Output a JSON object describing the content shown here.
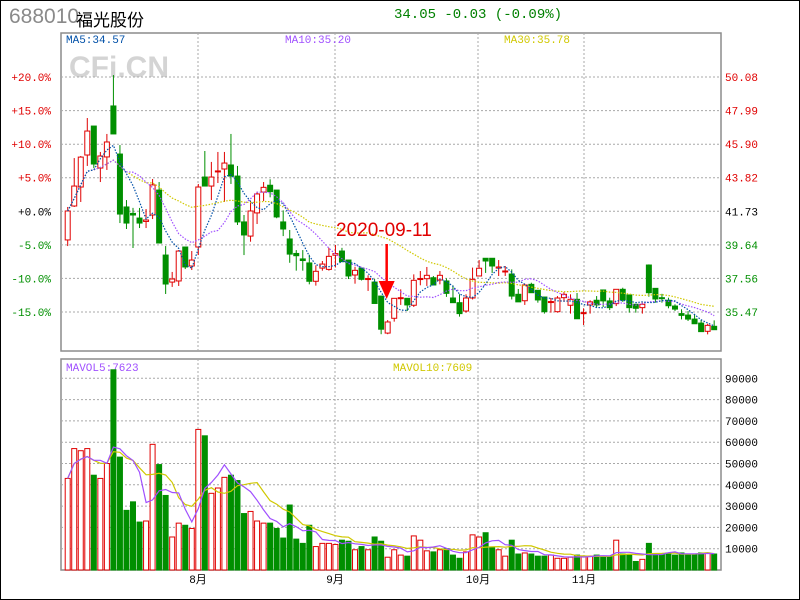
{
  "header": {
    "code": "688010",
    "name": "福光股份",
    "quote": "34.05 -0.03 (-0.09%)"
  },
  "watermark": "CFi.CN",
  "colors": {
    "up": "#e00000",
    "down": "#008f00",
    "ma5": "#0050a8",
    "ma10": "#a050ff",
    "ma30": "#d0c800",
    "grid": "#a8a8a8",
    "frame": "#8c8c8c"
  },
  "chart_data": [
    {
      "type": "candlestick",
      "title": "MA5:34.57  MA10:35.20  MA30:35.78",
      "legend": [
        "MA5:34.57",
        "MA10:35.20",
        "MA30:35.78"
      ],
      "base_price": 41.73,
      "ylim": [
        33.9,
        50.8
      ],
      "left_ticks": [
        {
          "value": 50.08,
          "label": "+20.0%"
        },
        {
          "value": 47.99,
          "label": "+15.0%"
        },
        {
          "value": 45.9,
          "label": "+10.0%"
        },
        {
          "value": 43.82,
          "label": "+5.0%"
        },
        {
          "value": 41.73,
          "label": "+0.0%"
        },
        {
          "value": 39.64,
          "label": "-5.0%"
        },
        {
          "value": 37.56,
          "label": "-10.0%"
        },
        {
          "value": 35.47,
          "label": "-15.0%"
        }
      ],
      "right_ticks": [
        "50.08",
        "47.99",
        "45.90",
        "43.82",
        "41.73",
        "39.64",
        "37.56",
        "35.47"
      ],
      "annotation": {
        "label": "2020-09-11",
        "candle_index": 49
      },
      "ohlc": [
        [
          39.95,
          42.0,
          39.57,
          41.75
        ],
        [
          42.06,
          45.04,
          42.0,
          43.3
        ],
        [
          43.24,
          45.17,
          42.31,
          45.1
        ],
        [
          45.23,
          47.53,
          44.55,
          46.72
        ],
        [
          47.03,
          47.03,
          44.42,
          44.67
        ],
        [
          44.42,
          45.42,
          43.55,
          45.17
        ],
        [
          45.11,
          46.54,
          44.3,
          46.04
        ],
        [
          48.28,
          50.2,
          46.54,
          46.54
        ],
        [
          45.29,
          45.85,
          41.0,
          41.56
        ],
        [
          42.0,
          42.43,
          40.63,
          41.0
        ],
        [
          41.6,
          41.94,
          39.45,
          41.5
        ],
        [
          41.31,
          41.94,
          40.69,
          41.0
        ],
        [
          41.1,
          41.87,
          40.69,
          41.19
        ],
        [
          41.5,
          43.74,
          41.25,
          43.37
        ],
        [
          43.05,
          43.55,
          39.76,
          39.76
        ],
        [
          39.01,
          39.57,
          36.59,
          37.21
        ],
        [
          37.33,
          37.96,
          37.03,
          37.52
        ],
        [
          37.4,
          39.32,
          37.09,
          39.26
        ],
        [
          39.51,
          39.51,
          38.14,
          38.27
        ],
        [
          38.33,
          39.26,
          38.08,
          38.7
        ],
        [
          39.51,
          43.43,
          39.01,
          43.24
        ],
        [
          43.86,
          45.48,
          43.3,
          43.3
        ],
        [
          43.3,
          44.8,
          42.43,
          43.86
        ],
        [
          44.2,
          45.42,
          43.49,
          44.24
        ],
        [
          44.36,
          45.42,
          42.31,
          44.73
        ],
        [
          44.61,
          46.54,
          43.43,
          43.92
        ],
        [
          43.92,
          44.55,
          40.88,
          41.07
        ],
        [
          41.07,
          41.5,
          39.01,
          40.26
        ],
        [
          40.19,
          42.37,
          39.84,
          41.75
        ],
        [
          41.63,
          42.95,
          40.94,
          42.81
        ],
        [
          42.93,
          43.55,
          42.37,
          43.22
        ],
        [
          43.35,
          43.72,
          42.6,
          42.95
        ],
        [
          43.05,
          43.05,
          41.3,
          41.38
        ],
        [
          41.07,
          41.79,
          40.19,
          40.63
        ],
        [
          40.01,
          40.57,
          38.53,
          39.07
        ],
        [
          39.11,
          39.32,
          38.04,
          38.97
        ],
        [
          38.77,
          39.32,
          38.04,
          38.67
        ],
        [
          38.52,
          39.03,
          37.19,
          37.38
        ],
        [
          37.38,
          38.37,
          37.11,
          38.0
        ],
        [
          38.2,
          38.64,
          38.04,
          38.45
        ],
        [
          38.12,
          39.46,
          38.04,
          38.93
        ],
        [
          39.0,
          39.64,
          38.24,
          39.1
        ],
        [
          39.26,
          39.46,
          38.6,
          38.6
        ],
        [
          38.7,
          38.7,
          37.52,
          37.71
        ],
        [
          37.77,
          38.28,
          37.23,
          38.06
        ],
        [
          38.2,
          38.2,
          37.43,
          37.5
        ],
        [
          37.5,
          37.75,
          36.78,
          37.55
        ],
        [
          37.33,
          37.52,
          36.0,
          36.0
        ],
        [
          36.46,
          36.46,
          34.09,
          34.4
        ],
        [
          34.16,
          34.97,
          34.09,
          34.85
        ],
        [
          35.08,
          36.34,
          34.87,
          36.32
        ],
        [
          36.3,
          36.88,
          35.91,
          36.36
        ],
        [
          36.32,
          36.32,
          35.53,
          35.91
        ],
        [
          35.89,
          37.81,
          35.78,
          37.44
        ],
        [
          37.5,
          38.02,
          37.13,
          37.55
        ],
        [
          37.54,
          38.27,
          37.09,
          37.75
        ],
        [
          37.6,
          37.71,
          37.15,
          37.15
        ],
        [
          37.46,
          38.02,
          37.19,
          37.75
        ],
        [
          37.4,
          37.56,
          36.41,
          36.63
        ],
        [
          36.34,
          37.13,
          36.05,
          36.05
        ],
        [
          36.05,
          36.57,
          35.18,
          35.37
        ],
        [
          35.53,
          36.57,
          35.43,
          36.34
        ],
        [
          36.34,
          38.23,
          36.25,
          37.5
        ],
        [
          37.71,
          38.7,
          37.71,
          38.19
        ],
        [
          38.81,
          38.81,
          37.9,
          38.64
        ],
        [
          38.81,
          38.81,
          37.9,
          38.33
        ],
        [
          38.2,
          38.7,
          37.71,
          38.27
        ],
        [
          38.0,
          38.33,
          37.71,
          38.02
        ],
        [
          37.83,
          38.12,
          36.25,
          36.46
        ],
        [
          36.57,
          36.9,
          36.1,
          36.1
        ],
        [
          36.17,
          37.15,
          35.91,
          37.15
        ],
        [
          37.19,
          37.29,
          36.67,
          36.67
        ],
        [
          36.82,
          36.82,
          36.05,
          36.22
        ],
        [
          36.4,
          36.4,
          35.37,
          35.49
        ],
        [
          36.1,
          36.34,
          35.43,
          36.12
        ],
        [
          35.49,
          36.46,
          35.43,
          36.34
        ],
        [
          36.36,
          36.71,
          36.1,
          36.57
        ],
        [
          35.89,
          36.57,
          35.37,
          36.26
        ],
        [
          36.26,
          36.65,
          35.05,
          35.05
        ],
        [
          35.4,
          35.7,
          34.66,
          35.43
        ],
        [
          35.91,
          36.2,
          35.37,
          36.1
        ],
        [
          36.2,
          36.46,
          35.74,
          35.91
        ],
        [
          36.84,
          36.84,
          35.78,
          36.16
        ],
        [
          36.16,
          36.36,
          35.59,
          35.74
        ],
        [
          35.99,
          36.88,
          35.84,
          36.88
        ],
        [
          36.88,
          36.98,
          36.1,
          36.22
        ],
        [
          36.53,
          36.53,
          35.43,
          35.74
        ],
        [
          35.95,
          35.95,
          35.43,
          35.7
        ],
        [
          35.74,
          36.05,
          35.37,
          35.95
        ],
        [
          38.39,
          38.43,
          36.42,
          36.67
        ],
        [
          36.94,
          36.94,
          36.05,
          36.28
        ],
        [
          36.36,
          36.6,
          36.05,
          36.3
        ],
        [
          36.2,
          36.36,
          35.7,
          35.86
        ],
        [
          35.84,
          35.95,
          35.53,
          35.65
        ],
        [
          35.37,
          35.64,
          35.01,
          35.26
        ],
        [
          35.28,
          35.53,
          34.91,
          35.03
        ],
        [
          35.03,
          35.34,
          34.74,
          34.74
        ],
        [
          34.78,
          34.97,
          34.25,
          34.25
        ],
        [
          34.27,
          34.74,
          34.08,
          34.64
        ],
        [
          34.58,
          34.95,
          34.37,
          34.37
        ]
      ]
    },
    {
      "type": "bar",
      "title": "MAVOL5:7623  MAVOL10:7609",
      "legend": [
        "MAVOL5:7623",
        "MAVOL10:7609"
      ],
      "ylim": [
        0,
        95000
      ],
      "y_ticks": [
        "90000",
        "80000",
        "70000",
        "60000",
        "50000",
        "40000",
        "30000",
        "20000",
        "10000"
      ],
      "x_ticks": [
        {
          "label": "8月",
          "index": 20
        },
        {
          "label": "9月",
          "index": 41
        },
        {
          "label": "10月",
          "index": 63
        },
        {
          "label": "11月",
          "index": 79
        }
      ],
      "values": [
        43000,
        57000,
        56000,
        57000,
        44500,
        43000,
        50000,
        94000,
        53000,
        28000,
        32000,
        22500,
        23000,
        59000,
        49500,
        35000,
        15500,
        22000,
        21000,
        19500,
        66000,
        63000,
        36000,
        38500,
        43500,
        44500,
        42000,
        26500,
        27500,
        23000,
        22000,
        22000,
        19500,
        15000,
        30500,
        14500,
        12500,
        21000,
        11000,
        12500,
        12500,
        12000,
        14000,
        13500,
        9500,
        11000,
        9500,
        15500,
        13500,
        6000,
        9500,
        7000,
        6500,
        16000,
        14000,
        9000,
        8500,
        9500,
        10000,
        7000,
        5500,
        8500,
        16500,
        15500,
        17500,
        10500,
        9500,
        6500,
        14000,
        7500,
        8000,
        7500,
        6500,
        6500,
        7000,
        5500,
        5500,
        6000,
        7000,
        6500,
        6500,
        7000,
        6500,
        6500,
        14000,
        7500,
        7000,
        4000,
        5000,
        12500,
        7500,
        7500,
        8000,
        7000,
        8000,
        7500,
        7500,
        8000,
        8000,
        7500
      ]
    }
  ]
}
